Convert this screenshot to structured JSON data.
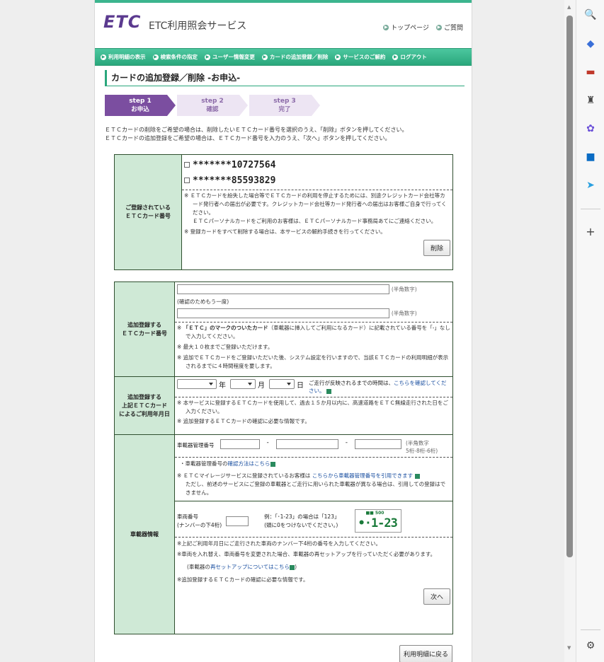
{
  "header": {
    "logo": "ETC",
    "site_title": "ETC利用照会サービス",
    "links": [
      "トップページ",
      "ご質問"
    ]
  },
  "nav": [
    "利用明細の表示",
    "検索条件の指定",
    "ユーザー情報変更",
    "カードの追加登録／削除",
    "サービスのご解約",
    "ログアウト"
  ],
  "page_title": "カードの追加登録／削除 -お申込-",
  "steps": [
    {
      "label": "step 1",
      "sub": "お申込"
    },
    {
      "label": "step 2",
      "sub": "確認"
    },
    {
      "label": "step 3",
      "sub": "完了"
    }
  ],
  "intro": [
    "ＥＴＣカードの削除をご希望の場合は、削除したいＥＴＣカード番号を選択のうえ、「削除」ボタンを押してください。",
    "ＥＴＣカードの追加登録をご希望の場合は、ＥＴＣカード番号を入力のうえ、「次へ」ボタンを押してください。"
  ],
  "registered": {
    "label_line1": "ご登録されている",
    "label_line2": "ＥＴＣカード番号",
    "cards": [
      "*******10727564",
      "*******85593829"
    ],
    "note1": "※ ＥＴＣカードを紛失した場合等でＥＴＣカードの利用を停止するためには、別途クレジットカード会社等カード発行者への届出が必要です。クレジットカード会社等カード発行者への届出はお客様ご自身で行ってください。",
    "note1b": "ＥＴＣパーソナルカードをご利用のお客様は、ＥＴＣパーソナルカード事務局あてにご連絡ください。",
    "note2": "※ 登録カードをすべて削除する場合は、本サービスの解約手続きを行ってください。",
    "delete_button": "削除"
  },
  "add_card": {
    "label_line1": "追加登録する",
    "label_line2": "ＥＴＣカード番号",
    "hint": "(半角数字)",
    "confirm_label": "(確認のためもう一度)",
    "note1_pre": "※ ",
    "note1_bold": "「ＥＴＣ」のマークのついたカード",
    "note1_rest": "（車載器に挿入してご利用になるカード）に記載されている番号を「-」なしで入力してください。",
    "note2": "※ 最大１０枚までご登録いただけます。",
    "note3": "※ 追加でＥＴＣカードをご登録いただいた後、システム設定を行いますので、当該ＥＴＣカードの利用明細が表示されるまでに４時間程度を要します。"
  },
  "date": {
    "label_line1": "追加登録する",
    "label_line2": "上記ＥＴＣカード",
    "label_line3": "によるご利用年月日",
    "year": "年",
    "month": "月",
    "day": "日",
    "side_text": "ご走行が反映されるまでの時間は、",
    "side_link": "こちらを確認してください。",
    "note1": "※ 本サービスに登録するＥＴＣカードを使用して、過去１５か月以内に、高速道路をＥＴＣ無線走行された日をご入力ください。",
    "note2": "※ 追加登録するＥＴＣカードの確認に必要な情報です。"
  },
  "device": {
    "label": "車載器情報",
    "mgmt_label": "車載器管理番号",
    "mgmt_hint_1": "(半角数字",
    "mgmt_hint_2": "5桁-8桁-6桁)",
    "mgmt_bullet": "・車載器管理番号の",
    "mgmt_link": "確認方法はこちら",
    "mileage_pre": "※ ＥＴＣマイレージサービスに登録されているお客様は ",
    "mileage_link": "こちらから車載器管理番号を引用できます",
    "mileage_note": "ただし、前述のサービスにご登録の車載器とご走行に用いられた車載器が異なる場合は、引用しての登録はできません。",
    "vehicle_label_1": "車両番号",
    "vehicle_label_2": "(ナンバーの下4桁)",
    "vehicle_example_1": "例：「･1-23」の場合は「123」",
    "vehicle_example_2": "(頭に0をつけないでください。)",
    "plate_top": "■■ 500",
    "plate_bottom": "•·1-23",
    "note1": "※上記ご利用年月日にご走行された車両のナンバー下4桁の番号を入力してください。",
    "note2": "※車両を入れ替え、車両番号を変更された場合、車載器の再セットアップを行っていただく必要があります。",
    "note3_pre": "(車載器の",
    "note3_link": "再セットアップについてはこちら",
    "note3_post": ")",
    "note4": "※追加登録するＥＴＣカードの確認に必要な情報です。",
    "next_button": "次へ"
  },
  "back_button": "利用明細に戻る",
  "colors": {
    "accent": "#2aa77c",
    "step_active": "#7b4ea0",
    "label_bg": "#cfe9d6"
  }
}
